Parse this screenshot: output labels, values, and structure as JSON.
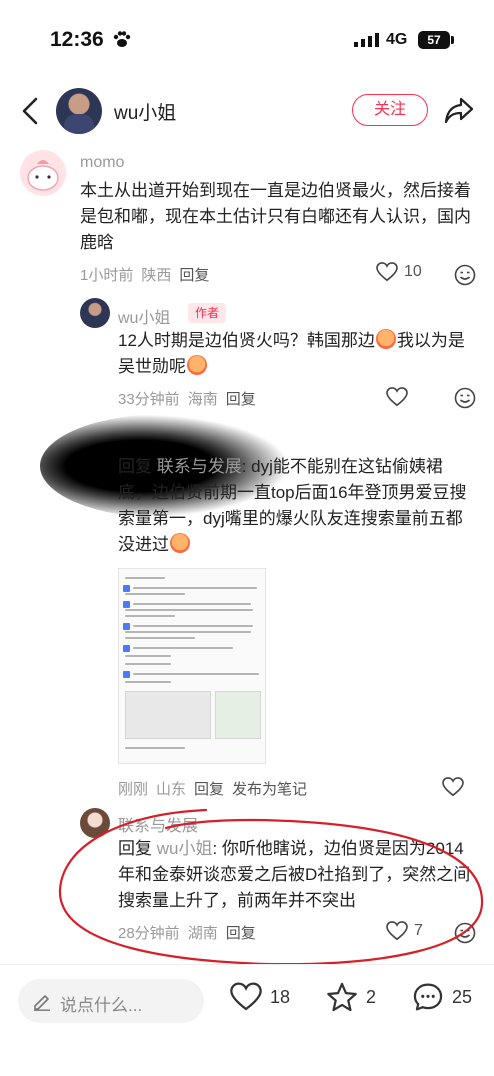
{
  "status_bar": {
    "time": "12:36",
    "network": "4G",
    "battery": "57"
  },
  "header": {
    "username": "wu小姐",
    "follow_label": "关注"
  },
  "comments": [
    {
      "name": "momo",
      "text": "本土从出道开始到现在一直是边伯贤最火，然后接着是包和嘟，现在本土估计只有白嘟还有人认识，国内鹿晗",
      "time": "1小时前",
      "location": "陕西",
      "reply_label": "回复",
      "likes": "10"
    },
    {
      "name": "wu小姐",
      "author_tag": "作者",
      "text_part1": "12人时期是边伯贤火吗？韩国那边",
      "text_part2": "我以为是吴世勋呢",
      "time": "33分钟前",
      "location": "海南",
      "reply_label": "回复"
    },
    {
      "reply_prefix": "回复",
      "reply_to": "联系与发展",
      "text": ": dyj能不能别在这钻偷姨裙底，边伯贤前期一直top后面16年登顶男爱豆搜索量第一，dyj嘴里的爆火队友连搜索量前五都没进过",
      "time": "刚刚",
      "location": "山东",
      "reply_label": "回复",
      "extra_label": "发布为笔记"
    },
    {
      "name": "联系与发展",
      "reply_prefix": "回复",
      "reply_to": "wu小姐",
      "text": ": 你听他瞎说，边伯贤是因为2014年和金泰妍谈恋爱之后被D社掐到了，突然之间搜索量上升了，前两年并不突出",
      "time": "28分钟前",
      "location": "湖南",
      "reply_label": "回复",
      "likes": "7"
    }
  ],
  "bottom_bar": {
    "input_placeholder": "说点什么...",
    "likes": "18",
    "favorites": "2",
    "comments": "25"
  },
  "colors": {
    "accent": "#ff2e4d",
    "annotation": "#d71f2a"
  },
  "icons": [
    "paw-icon",
    "signal-icon",
    "back-icon",
    "share-icon",
    "heart-icon",
    "sticker-icon",
    "pen-icon",
    "star-icon",
    "comment-icon"
  ]
}
